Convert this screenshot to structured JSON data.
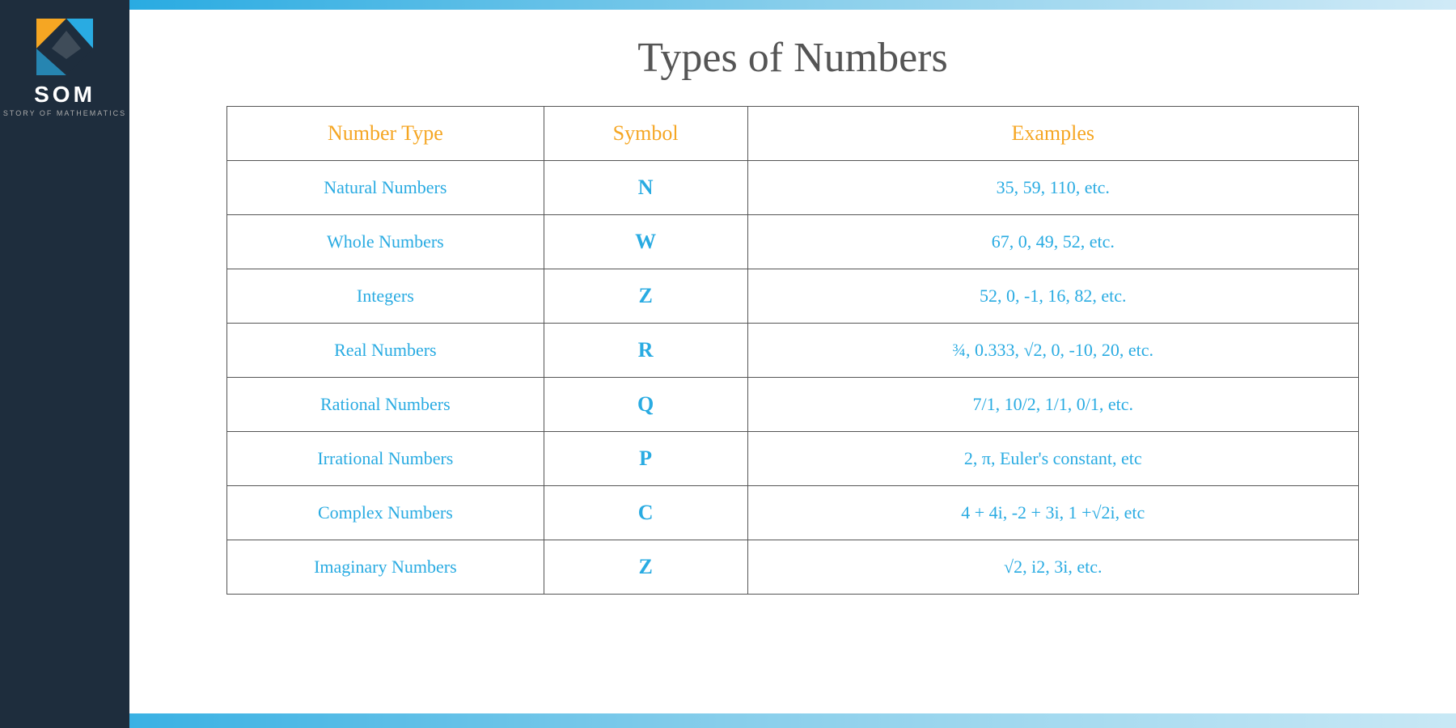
{
  "page": {
    "title": "Types of Numbers"
  },
  "logo": {
    "brand": "SOM",
    "subtitle": "STORY OF MATHEMATICS"
  },
  "table": {
    "headers": [
      "Number Type",
      "Symbol",
      "Examples"
    ],
    "rows": [
      {
        "type": "Natural Numbers",
        "symbol": "N",
        "examples": "35, 59, 110, etc."
      },
      {
        "type": "Whole Numbers",
        "symbol": "W",
        "examples": "67, 0, 49, 52, etc."
      },
      {
        "type": "Integers",
        "symbol": "Z",
        "examples": "52, 0, -1, 16, 82, etc."
      },
      {
        "type": "Real Numbers",
        "symbol": "R",
        "examples": "¾, 0.333, √2, 0, -10, 20, etc."
      },
      {
        "type": "Rational Numbers",
        "symbol": "Q",
        "examples": "7/1, 10/2, 1/1, 0/1, etc."
      },
      {
        "type": "Irrational Numbers",
        "symbol": "P",
        "examples": "2, π, Euler's constant, etc"
      },
      {
        "type": "Complex Numbers",
        "symbol": "C",
        "examples": "4 + 4i, -2 + 3i, 1 +√2i, etc"
      },
      {
        "type": "Imaginary Numbers",
        "symbol": "Z",
        "examples": "√2, i2, 3i, etc."
      }
    ]
  }
}
